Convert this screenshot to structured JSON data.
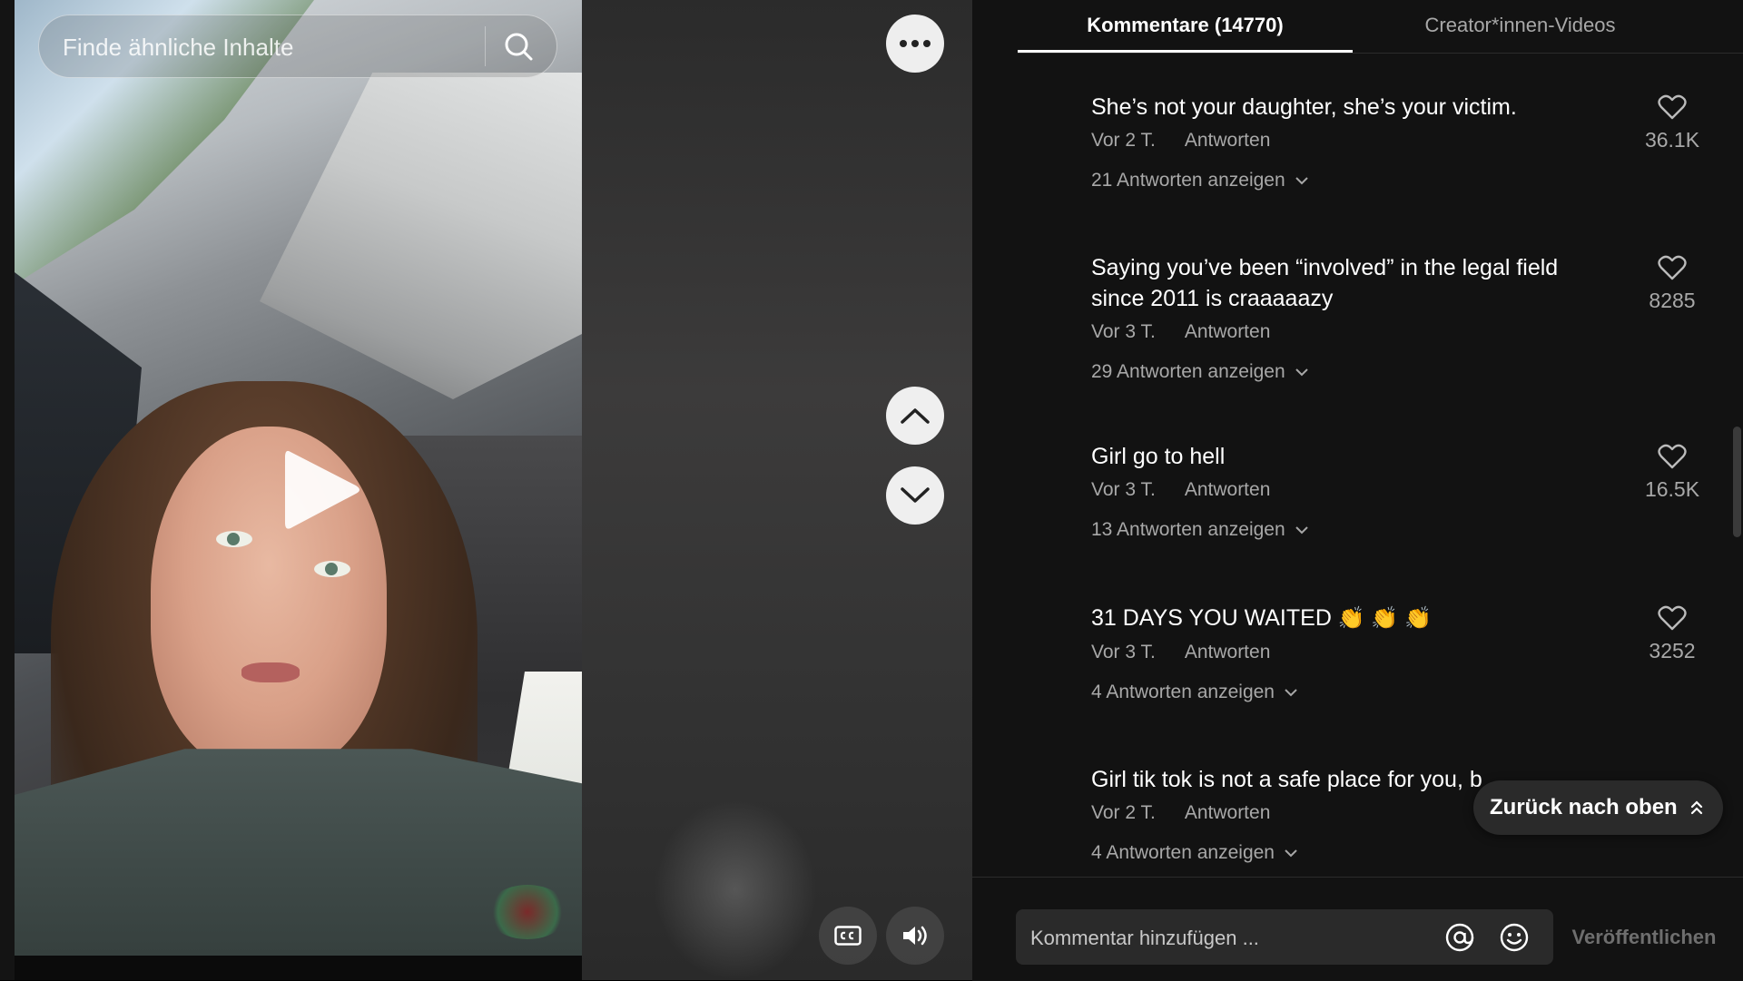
{
  "search": {
    "placeholder": "Finde ähnliche Inhalte"
  },
  "icons": {
    "search": "search-icon",
    "play": "play-icon",
    "more": "more-horizontal-icon",
    "prev": "chevron-up-icon",
    "next": "chevron-down-icon",
    "captions": "cc-icon",
    "volume": "volume-icon",
    "like": "heart-outline-icon",
    "mention": "at-sign-icon",
    "emoji": "emoji-icon",
    "back_to_top": "double-chevron-up-icon"
  },
  "tabs": [
    {
      "label": "Kommentare (14770)"
    },
    {
      "label": "Creator*innen-Videos"
    }
  ],
  "comments": [
    {
      "text": "She’s not your daughter, she’s your victim.",
      "time": "Vor 2 T.",
      "reply_label": "Antworten",
      "view_replies": "21 Antworten anzeigen",
      "likes": "36.1K"
    },
    {
      "text": "Saying you’ve been “involved” in the legal field since 2011 is craaaaazy",
      "time": "Vor 3 T.",
      "reply_label": "Antworten",
      "view_replies": "29 Antworten anzeigen",
      "likes": "8285"
    },
    {
      "text": "Girl go to hell",
      "time": "Vor 3 T.",
      "reply_label": "Antworten",
      "view_replies": "13 Antworten anzeigen",
      "likes": "16.5K"
    },
    {
      "text": "31 DAYS YOU WAITED",
      "emoji": "👏 👏 👏",
      "time": "Vor 3 T.",
      "reply_label": "Antworten",
      "view_replies": "4 Antworten anzeigen",
      "likes": "3252"
    },
    {
      "text": "Girl tik tok is not a safe place for you, b",
      "time": "Vor 2 T.",
      "reply_label": "Antworten",
      "view_replies": "4 Antworten anzeigen",
      "likes": ""
    }
  ],
  "back_to_top": {
    "label": "Zurück nach oben"
  },
  "comment_bar": {
    "placeholder": "Kommentar hinzufügen ...",
    "publish_label": "Veröffentlichen"
  },
  "colors": {
    "panel_bg": "#121212",
    "text_primary": "#ffffff",
    "text_secondary": "#a8a8a8"
  }
}
